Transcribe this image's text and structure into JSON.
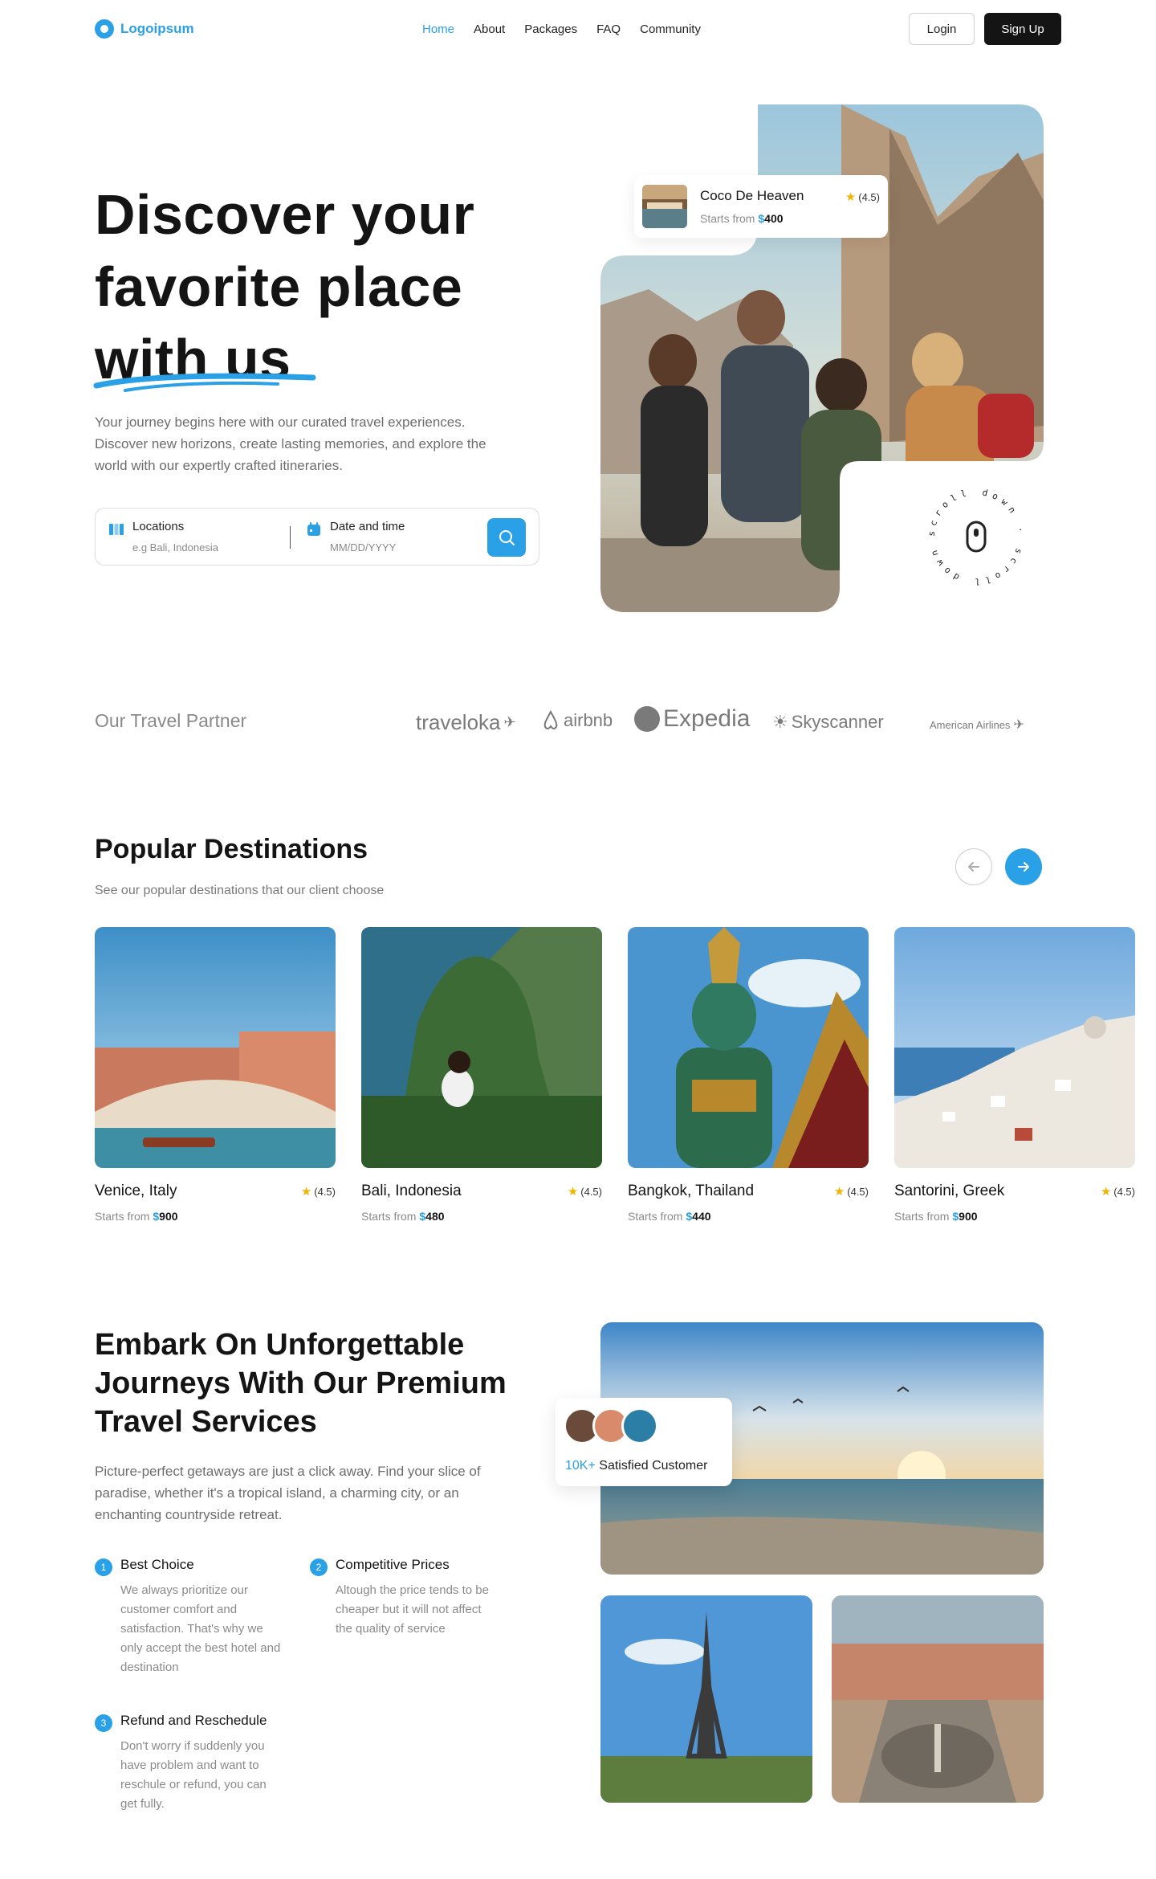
{
  "brand": {
    "name": "Logoipsum",
    "accent": "#2aa0e6"
  },
  "nav": {
    "items": [
      {
        "label": "Home",
        "active": true
      },
      {
        "label": "About"
      },
      {
        "label": "Packages"
      },
      {
        "label": "FAQ"
      },
      {
        "label": "Community"
      }
    ],
    "login_label": "Login",
    "signup_label": "Sign Up"
  },
  "hero": {
    "title_line1": "Discover your",
    "title_line2": "favorite place",
    "title_line3": "with us",
    "subtitle": "Your journey begins here with our curated travel experiences. Discover new horizons, create lasting memories, and explore the world with our expertly crafted itineraries.",
    "search": {
      "location_label": "Locations",
      "location_placeholder": "e.g Bali, Indonesia",
      "date_label": "Date and time",
      "date_placeholder": "MM/DD/YYYY",
      "icons": {
        "location": "map-icon",
        "date": "calendar-icon",
        "button": "search-icon"
      }
    },
    "featured": {
      "name": "Coco De Heaven",
      "price_prefix": "Starts from",
      "currency": "$",
      "price": "400",
      "rating": "(4.5)"
    },
    "scroll_text": "scroll down · scroll down ·"
  },
  "partners": {
    "title": "Our Travel Partner",
    "items": [
      "traveloka",
      "airbnb",
      "Expedia",
      "Skyscanner",
      "American Airlines"
    ]
  },
  "popular": {
    "title": "Popular Destinations",
    "subtitle": "See our popular destinations that our client choose",
    "price_prefix": "Starts from",
    "currency": "$",
    "destinations": [
      {
        "name": "Venice, Italy",
        "rating": "(4.5)",
        "price": "900"
      },
      {
        "name": "Bali, Indonesia",
        "rating": "(4.5)",
        "price": "480"
      },
      {
        "name": "Bangkok, Thailand",
        "rating": "(4.5)",
        "price": "440"
      },
      {
        "name": "Santorini, Greek",
        "rating": "(4.5)",
        "price": "900"
      }
    ]
  },
  "services": {
    "title": "Embark On Unforgettable Journeys With Our Premium Travel Services",
    "subtitle": "Picture-perfect getaways are just a click away. Find your slice of paradise, whether it's a tropical island, a charming city, or an enchanting countryside retreat.",
    "features": [
      {
        "num": "1",
        "title": "Best Choice",
        "text": "We always prioritize our customer comfort and satisfaction. That's why we only accept the best hotel and destination"
      },
      {
        "num": "2",
        "title": "Competitive Prices",
        "text": "Altough the price tends to be cheaper but it will not affect the quality of service"
      },
      {
        "num": "3",
        "title": "Refund and Reschedule",
        "text": "Don't worry if suddenly you have problem and want to reschule or refund, you can get fully."
      }
    ],
    "customers": {
      "count": "10K+",
      "label": "Satisfied Customer"
    }
  }
}
